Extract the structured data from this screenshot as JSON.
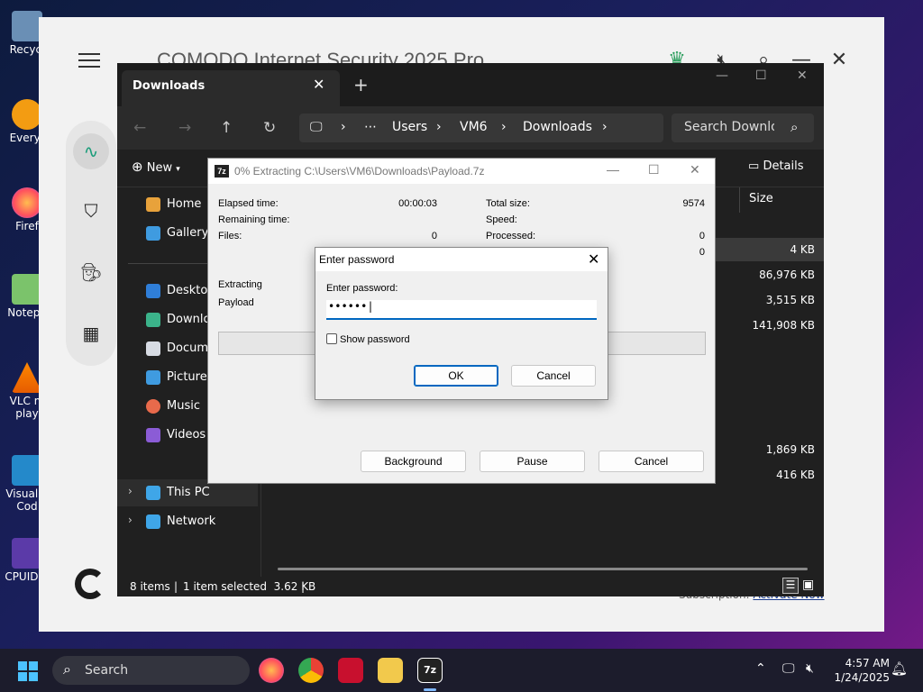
{
  "desktop": {
    "icons": [
      {
        "label": "Recycl"
      },
      {
        "label": "Everyt"
      },
      {
        "label": "Firef"
      },
      {
        "label": "Notepa"
      },
      {
        "label": "VLC m\nplay"
      },
      {
        "label": "Visual S\nCod"
      },
      {
        "label": "CPUID C"
      }
    ]
  },
  "comodo": {
    "title": "COMODO Internet Security 2025 Pro",
    "subscription_text": "Subscription:",
    "activate_link": "Activate Now"
  },
  "explorer": {
    "tab_title": "Downloads",
    "breadcrumb": [
      "Users",
      "VM6",
      "Downloads"
    ],
    "search_placeholder": "Search Downloa",
    "new_label": "New",
    "details_label": "Details",
    "column_size": "Size",
    "nav": {
      "home": "Home",
      "gallery": "Gallery",
      "desktop": "Desktop",
      "downloads": "Downloa",
      "documents": "Docume",
      "pictures": "Pictures",
      "music": "Music",
      "videos": "Videos",
      "this_pc": "This PC",
      "network": "Network"
    },
    "sizes": [
      "4 KB",
      "86,976 KB",
      "3,515 KB",
      "141,908 KB",
      "1,869 KB",
      "416 KB"
    ],
    "status": {
      "items": "8 items",
      "selected": "1 item selected  3.62 KB"
    }
  },
  "zip_progress": {
    "title": "0% Extracting C:\\Users\\VM6\\Downloads\\Payload.7z",
    "logo": "7z",
    "elapsed_label": "Elapsed time:",
    "elapsed_value": "00:00:03",
    "remaining_label": "Remaining time:",
    "files_label": "Files:",
    "files_value": "0",
    "total_size_label": "Total size:",
    "total_size_value": "9574",
    "speed_label": "Speed:",
    "processed_label": "Processed:",
    "processed_value": "0",
    "row4_value": "0",
    "status_line1": "Extracting",
    "status_line2": "Payload",
    "buttons": {
      "background": "Background",
      "pause": "Pause",
      "cancel": "Cancel"
    }
  },
  "password_dialog": {
    "title": "Enter password",
    "label": "Enter password:",
    "value": "••••••|",
    "show_password": "Show password",
    "ok": "OK",
    "cancel": "Cancel"
  },
  "taskbar": {
    "search_label": "Search",
    "time": "4:57 AM",
    "date": "1/24/2025",
    "apps_logo": "7z"
  }
}
